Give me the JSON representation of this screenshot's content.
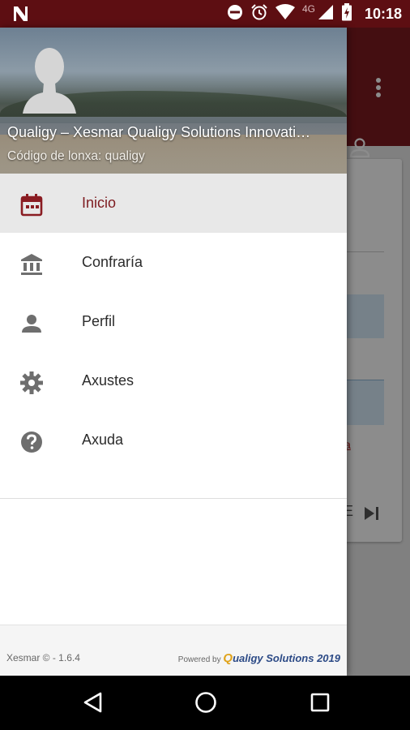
{
  "status_bar": {
    "network": "4G",
    "time": "10:18"
  },
  "drawer": {
    "org_name": "Qualigy – Xesmar Qualigy Solutions Innovati…",
    "lonxa_code": "Código de lonxa: qualigy",
    "menu": [
      {
        "label": "Inicio",
        "icon": "calendar-icon",
        "active": true
      },
      {
        "label": "Confraría",
        "icon": "bank-icon",
        "active": false
      },
      {
        "label": "Perfil",
        "icon": "person-icon",
        "active": false
      },
      {
        "label": "Axustes",
        "icon": "gear-icon",
        "active": false
      },
      {
        "label": "Axuda",
        "icon": "help-icon",
        "active": false
      }
    ],
    "footer": {
      "version": "Xesmar © - 1.6.4",
      "powered_by": "Powered by",
      "brand_first": "Q",
      "brand_rest": "ualigy Solutions 2019"
    }
  },
  "background": {
    "link_fragment": "a",
    "letter": "E"
  },
  "colors": {
    "status_bar": "#5d0e12",
    "toolbar": "#7d1a1f",
    "accent": "#7d1a1f",
    "brand_blue": "#2c4a86",
    "brand_gold": "#e0a31a"
  }
}
